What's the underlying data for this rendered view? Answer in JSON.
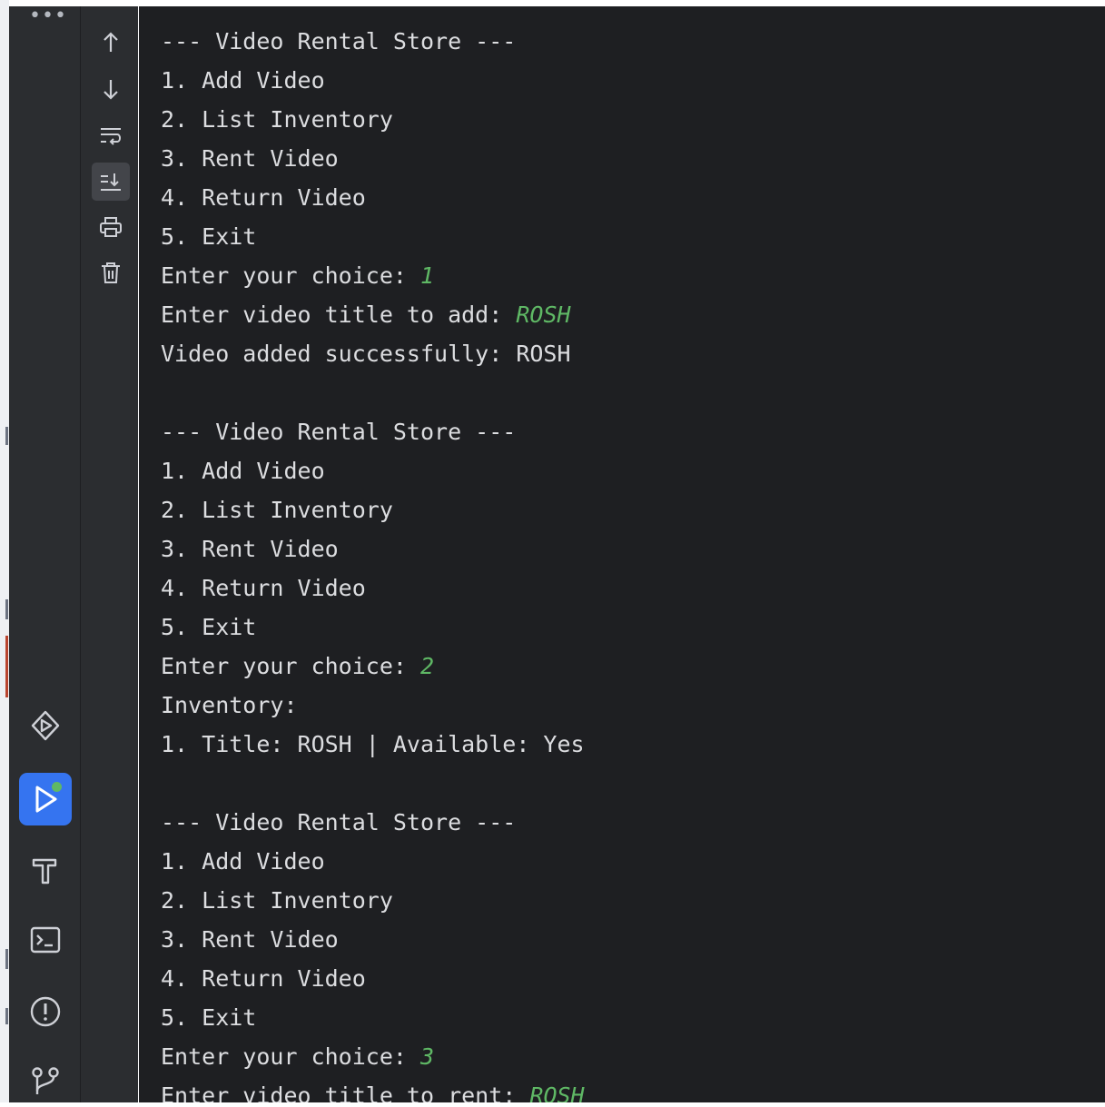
{
  "tool_window_bar": {
    "more": "•••",
    "buttons": [
      {
        "icon": "services-icon",
        "active": false
      },
      {
        "icon": "run-icon",
        "active": true
      },
      {
        "icon": "build-icon",
        "active": false
      },
      {
        "icon": "terminal-icon",
        "active": false
      },
      {
        "icon": "problems-icon",
        "active": false
      },
      {
        "icon": "git-icon",
        "active": false
      }
    ]
  },
  "console_toolbar": {
    "buttons": [
      {
        "icon": "up-arrow-icon"
      },
      {
        "icon": "down-arrow-icon"
      },
      {
        "icon": "soft-wrap-icon"
      },
      {
        "icon": "scroll-to-end-icon",
        "selected": true
      },
      {
        "icon": "print-icon"
      },
      {
        "icon": "clear-all-icon"
      }
    ]
  },
  "colors": {
    "console_bg": "#1e1f22",
    "text": "#dcdde0",
    "user_input": "#5fb865",
    "accent": "#3574f0"
  },
  "console": {
    "lines": [
      {
        "text": "--- Video Rental Store ---"
      },
      {
        "text": "1. Add Video"
      },
      {
        "text": "2. List Inventory"
      },
      {
        "text": "3. Rent Video"
      },
      {
        "text": "4. Return Video"
      },
      {
        "text": "5. Exit"
      },
      {
        "text": "Enter your choice: ",
        "input": "1"
      },
      {
        "text": "Enter video title to add: ",
        "input": "ROSH"
      },
      {
        "text": "Video added successfully: ROSH"
      },
      {
        "text": ""
      },
      {
        "text": "--- Video Rental Store ---"
      },
      {
        "text": "1. Add Video"
      },
      {
        "text": "2. List Inventory"
      },
      {
        "text": "3. Rent Video"
      },
      {
        "text": "4. Return Video"
      },
      {
        "text": "5. Exit"
      },
      {
        "text": "Enter your choice: ",
        "input": "2"
      },
      {
        "text": "Inventory:"
      },
      {
        "text": "1. Title: ROSH | Available: Yes"
      },
      {
        "text": ""
      },
      {
        "text": "--- Video Rental Store ---"
      },
      {
        "text": "1. Add Video"
      },
      {
        "text": "2. List Inventory"
      },
      {
        "text": "3. Rent Video"
      },
      {
        "text": "4. Return Video"
      },
      {
        "text": "5. Exit"
      },
      {
        "text": "Enter your choice: ",
        "input": "3"
      },
      {
        "text": "Enter video title to rent: ",
        "input": "ROSH"
      }
    ]
  }
}
